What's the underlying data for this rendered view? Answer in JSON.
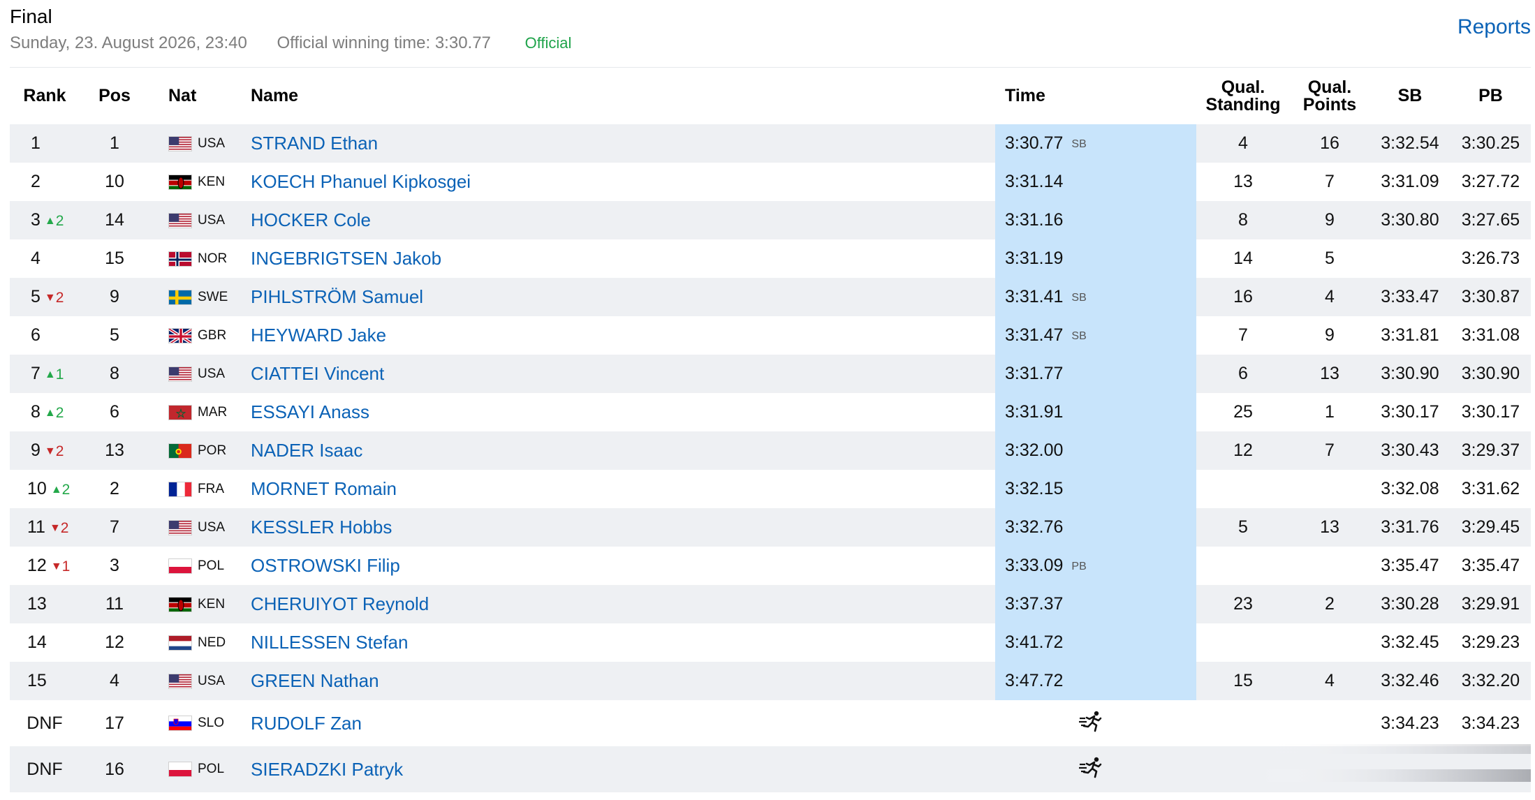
{
  "header": {
    "title": "Final",
    "date": "Sunday, 23. August 2026, 23:40",
    "winning_time": "Official winning time: 3:30.77",
    "status": "Official",
    "reports_link": "Reports"
  },
  "columns": {
    "rank": "Rank",
    "pos": "Pos",
    "nat": "Nat",
    "name": "Name",
    "time": "Time",
    "qual_standing_1": "Qual.",
    "qual_standing_2": "Standing",
    "qual_points_1": "Qual.",
    "qual_points_2": "Points",
    "sb": "SB",
    "pb": "PB"
  },
  "rows": [
    {
      "rank": "1",
      "change": "",
      "dir": "",
      "pos": "1",
      "nat": "USA",
      "name": "STRAND Ethan",
      "time": "3:30.77",
      "note": "SB",
      "qs": "4",
      "qp": "16",
      "sb": "3:32.54",
      "pb": "3:30.25"
    },
    {
      "rank": "2",
      "change": "",
      "dir": "",
      "pos": "10",
      "nat": "KEN",
      "name": "KOECH Phanuel Kipkosgei",
      "time": "3:31.14",
      "note": "",
      "qs": "13",
      "qp": "7",
      "sb": "3:31.09",
      "pb": "3:27.72"
    },
    {
      "rank": "3",
      "change": "2",
      "dir": "up",
      "pos": "14",
      "nat": "USA",
      "name": "HOCKER Cole",
      "time": "3:31.16",
      "note": "",
      "qs": "8",
      "qp": "9",
      "sb": "3:30.80",
      "pb": "3:27.65"
    },
    {
      "rank": "4",
      "change": "",
      "dir": "",
      "pos": "15",
      "nat": "NOR",
      "name": "INGEBRIGTSEN Jakob",
      "time": "3:31.19",
      "note": "",
      "qs": "14",
      "qp": "5",
      "sb": "",
      "pb": "3:26.73"
    },
    {
      "rank": "5",
      "change": "2",
      "dir": "down",
      "pos": "9",
      "nat": "SWE",
      "name": "PIHLSTRÖM Samuel",
      "time": "3:31.41",
      "note": "SB",
      "qs": "16",
      "qp": "4",
      "sb": "3:33.47",
      "pb": "3:30.87"
    },
    {
      "rank": "6",
      "change": "",
      "dir": "",
      "pos": "5",
      "nat": "GBR",
      "name": "HEYWARD Jake",
      "time": "3:31.47",
      "note": "SB",
      "qs": "7",
      "qp": "9",
      "sb": "3:31.81",
      "pb": "3:31.08"
    },
    {
      "rank": "7",
      "change": "1",
      "dir": "up",
      "pos": "8",
      "nat": "USA",
      "name": "CIATTEI Vincent",
      "time": "3:31.77",
      "note": "",
      "qs": "6",
      "qp": "13",
      "sb": "3:30.90",
      "pb": "3:30.90"
    },
    {
      "rank": "8",
      "change": "2",
      "dir": "up",
      "pos": "6",
      "nat": "MAR",
      "name": "ESSAYI Anass",
      "time": "3:31.91",
      "note": "",
      "qs": "25",
      "qp": "1",
      "sb": "3:30.17",
      "pb": "3:30.17"
    },
    {
      "rank": "9",
      "change": "2",
      "dir": "down",
      "pos": "13",
      "nat": "POR",
      "name": "NADER Isaac",
      "time": "3:32.00",
      "note": "",
      "qs": "12",
      "qp": "7",
      "sb": "3:30.43",
      "pb": "3:29.37"
    },
    {
      "rank": "10",
      "change": "2",
      "dir": "up",
      "pos": "2",
      "nat": "FRA",
      "name": "MORNET Romain",
      "time": "3:32.15",
      "note": "",
      "qs": "",
      "qp": "",
      "sb": "3:32.08",
      "pb": "3:31.62"
    },
    {
      "rank": "11",
      "change": "2",
      "dir": "down",
      "pos": "7",
      "nat": "USA",
      "name": "KESSLER Hobbs",
      "time": "3:32.76",
      "note": "",
      "qs": "5",
      "qp": "13",
      "sb": "3:31.76",
      "pb": "3:29.45"
    },
    {
      "rank": "12",
      "change": "1",
      "dir": "down",
      "pos": "3",
      "nat": "POL",
      "name": "OSTROWSKI Filip",
      "time": "3:33.09",
      "note": "PB",
      "qs": "",
      "qp": "",
      "sb": "3:35.47",
      "pb": "3:35.47"
    },
    {
      "rank": "13",
      "change": "",
      "dir": "",
      "pos": "11",
      "nat": "KEN",
      "name": "CHERUIYOT Reynold",
      "time": "3:37.37",
      "note": "",
      "qs": "23",
      "qp": "2",
      "sb": "3:30.28",
      "pb": "3:29.91"
    },
    {
      "rank": "14",
      "change": "",
      "dir": "",
      "pos": "12",
      "nat": "NED",
      "name": "NILLESSEN Stefan",
      "time": "3:41.72",
      "note": "",
      "qs": "",
      "qp": "",
      "sb": "3:32.45",
      "pb": "3:29.23"
    },
    {
      "rank": "15",
      "change": "",
      "dir": "",
      "pos": "4",
      "nat": "USA",
      "name": "GREEN Nathan",
      "time": "3:47.72",
      "note": "",
      "qs": "15",
      "qp": "4",
      "sb": "3:32.46",
      "pb": "3:32.20"
    },
    {
      "rank": "DNF",
      "change": "",
      "dir": "",
      "pos": "17",
      "nat": "SLO",
      "name": "RUDOLF Zan",
      "time": "",
      "note": "",
      "dnf_icon": "runner-dnf-icon",
      "qs": "",
      "qp": "",
      "sb": "3:34.23",
      "pb": "3:34.23"
    },
    {
      "rank": "DNF",
      "change": "",
      "dir": "",
      "pos": "16",
      "nat": "POL",
      "name": "SIERADZKI Patryk",
      "time": "",
      "note": "",
      "dnf_icon": "runner-dnf-icon",
      "qs": "",
      "qp": "",
      "sb": "",
      "pb": ""
    }
  ],
  "colors": {
    "link": "#0b62b6",
    "official": "#1fa34a",
    "up": "#23a84a",
    "down": "#c62828",
    "time_highlight": "#c8e4fb",
    "row_alt": "#eef0f3"
  }
}
